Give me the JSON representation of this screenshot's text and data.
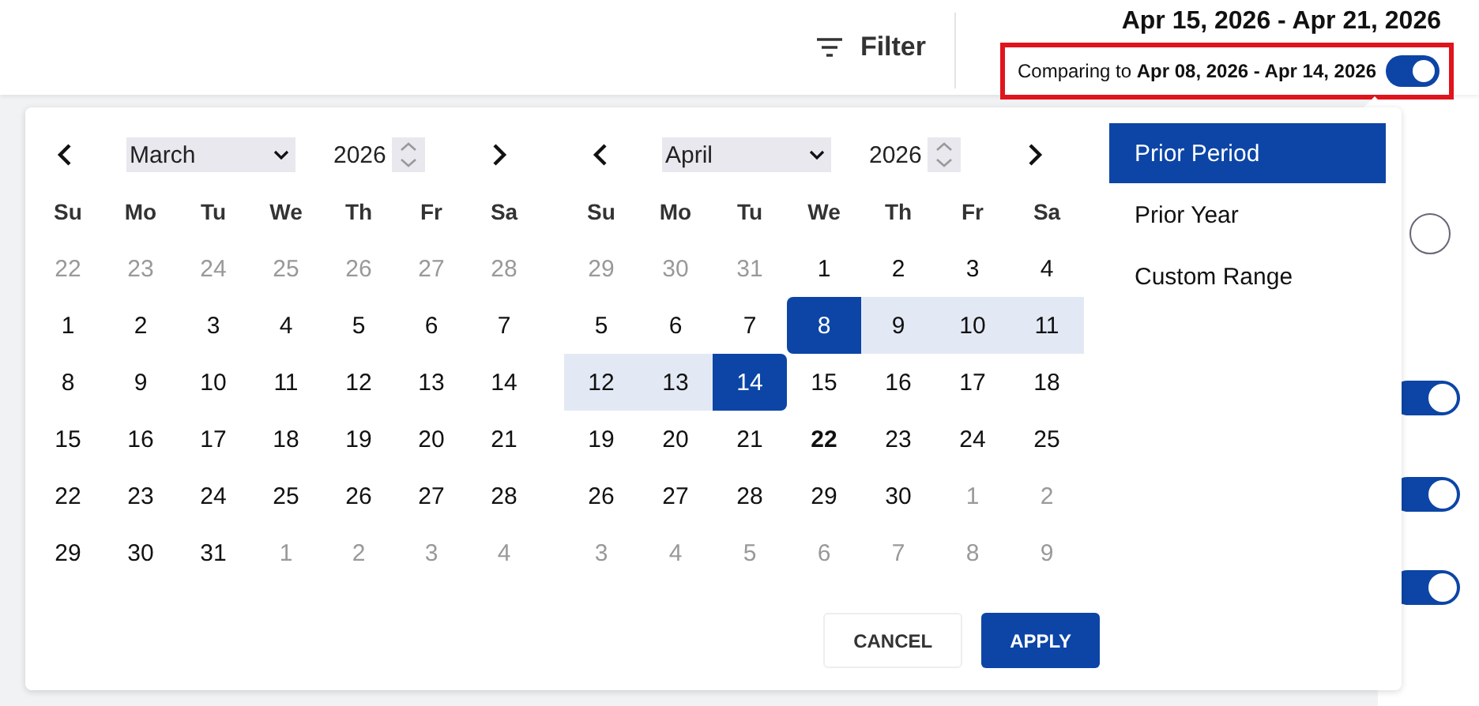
{
  "header": {
    "filter_label": "Filter",
    "date_range": "Apr 15, 2026 - Apr 21, 2026",
    "comparison": {
      "text": "Comparing to **Apr 08, 2026 - Apr 14, 2026**",
      "on": true,
      "highlighted": true
    }
  },
  "calendars": [
    {
      "month": "March",
      "year": "2026",
      "weekdays": [
        "Su",
        "Mo",
        "Tu",
        "We",
        "Th",
        "Fr",
        "Sa"
      ],
      "weeks": [
        [
          {
            "day": "22",
            "kind": "outside"
          },
          {
            "day": "23",
            "kind": "outside"
          },
          {
            "day": "24",
            "kind": "outside"
          },
          {
            "day": "25",
            "kind": "outside"
          },
          {
            "day": "26",
            "kind": "outside"
          },
          {
            "day": "27",
            "kind": "outside"
          },
          {
            "day": "28",
            "kind": "outside"
          }
        ],
        [
          {
            "day": "1",
            "kind": "normal"
          },
          {
            "day": "2",
            "kind": "normal"
          },
          {
            "day": "3",
            "kind": "normal"
          },
          {
            "day": "4",
            "kind": "normal"
          },
          {
            "day": "5",
            "kind": "normal"
          },
          {
            "day": "6",
            "kind": "normal"
          },
          {
            "day": "7",
            "kind": "normal"
          }
        ],
        [
          {
            "day": "8",
            "kind": "normal"
          },
          {
            "day": "9",
            "kind": "normal"
          },
          {
            "day": "10",
            "kind": "normal"
          },
          {
            "day": "11",
            "kind": "normal"
          },
          {
            "day": "12",
            "kind": "normal"
          },
          {
            "day": "13",
            "kind": "normal"
          },
          {
            "day": "14",
            "kind": "normal"
          }
        ],
        [
          {
            "day": "15",
            "kind": "normal"
          },
          {
            "day": "16",
            "kind": "normal"
          },
          {
            "day": "17",
            "kind": "normal"
          },
          {
            "day": "18",
            "kind": "normal"
          },
          {
            "day": "19",
            "kind": "normal"
          },
          {
            "day": "20",
            "kind": "normal"
          },
          {
            "day": "21",
            "kind": "normal"
          }
        ],
        [
          {
            "day": "22",
            "kind": "normal"
          },
          {
            "day": "23",
            "kind": "normal"
          },
          {
            "day": "24",
            "kind": "normal"
          },
          {
            "day": "25",
            "kind": "normal"
          },
          {
            "day": "26",
            "kind": "normal"
          },
          {
            "day": "27",
            "kind": "normal"
          },
          {
            "day": "28",
            "kind": "normal"
          }
        ],
        [
          {
            "day": "29",
            "kind": "normal"
          },
          {
            "day": "30",
            "kind": "normal"
          },
          {
            "day": "31",
            "kind": "normal"
          },
          {
            "day": "1",
            "kind": "outside"
          },
          {
            "day": "2",
            "kind": "outside"
          },
          {
            "day": "3",
            "kind": "outside"
          },
          {
            "day": "4",
            "kind": "outside"
          }
        ]
      ]
    },
    {
      "month": "April",
      "year": "2026",
      "weekdays": [
        "Su",
        "Mo",
        "Tu",
        "We",
        "Th",
        "Fr",
        "Sa"
      ],
      "weeks": [
        [
          {
            "day": "29",
            "kind": "outside"
          },
          {
            "day": "30",
            "kind": "outside"
          },
          {
            "day": "31",
            "kind": "outside"
          },
          {
            "day": "1",
            "kind": "normal"
          },
          {
            "day": "2",
            "kind": "normal"
          },
          {
            "day": "3",
            "kind": "normal"
          },
          {
            "day": "4",
            "kind": "normal"
          }
        ],
        [
          {
            "day": "5",
            "kind": "normal"
          },
          {
            "day": "6",
            "kind": "normal"
          },
          {
            "day": "7",
            "kind": "normal"
          },
          {
            "day": "8",
            "kind": "start"
          },
          {
            "day": "9",
            "kind": "range"
          },
          {
            "day": "10",
            "kind": "range"
          },
          {
            "day": "11",
            "kind": "range"
          }
        ],
        [
          {
            "day": "12",
            "kind": "range"
          },
          {
            "day": "13",
            "kind": "range"
          },
          {
            "day": "14",
            "kind": "end"
          },
          {
            "day": "15",
            "kind": "normal"
          },
          {
            "day": "16",
            "kind": "normal"
          },
          {
            "day": "17",
            "kind": "normal"
          },
          {
            "day": "18",
            "kind": "normal"
          }
        ],
        [
          {
            "day": "19",
            "kind": "normal"
          },
          {
            "day": "20",
            "kind": "normal"
          },
          {
            "day": "21",
            "kind": "normal"
          },
          {
            "day": "22",
            "kind": "today"
          },
          {
            "day": "23",
            "kind": "normal"
          },
          {
            "day": "24",
            "kind": "normal"
          },
          {
            "day": "25",
            "kind": "normal"
          }
        ],
        [
          {
            "day": "26",
            "kind": "normal"
          },
          {
            "day": "27",
            "kind": "normal"
          },
          {
            "day": "28",
            "kind": "normal"
          },
          {
            "day": "29",
            "kind": "normal"
          },
          {
            "day": "30",
            "kind": "normal"
          },
          {
            "day": "1",
            "kind": "outside"
          },
          {
            "day": "2",
            "kind": "outside"
          }
        ],
        [
          {
            "day": "3",
            "kind": "outside"
          },
          {
            "day": "4",
            "kind": "outside"
          },
          {
            "day": "5",
            "kind": "outside"
          },
          {
            "day": "6",
            "kind": "outside"
          },
          {
            "day": "7",
            "kind": "outside"
          },
          {
            "day": "8",
            "kind": "outside"
          },
          {
            "day": "9",
            "kind": "outside"
          }
        ]
      ]
    }
  ],
  "presets": [
    {
      "label": "Prior Period",
      "selected": true
    },
    {
      "label": "Prior Year",
      "selected": false
    },
    {
      "label": "Custom Range",
      "selected": false
    }
  ],
  "buttons": [
    {
      "label": "CANCEL",
      "kind": "secondary"
    },
    {
      "label": "APPLY",
      "kind": "primary"
    }
  ],
  "background": {
    "radio": {
      "selected": false
    },
    "toggles": [
      {
        "on": true
      },
      {
        "on": true
      },
      {
        "on": true
      }
    ]
  }
}
